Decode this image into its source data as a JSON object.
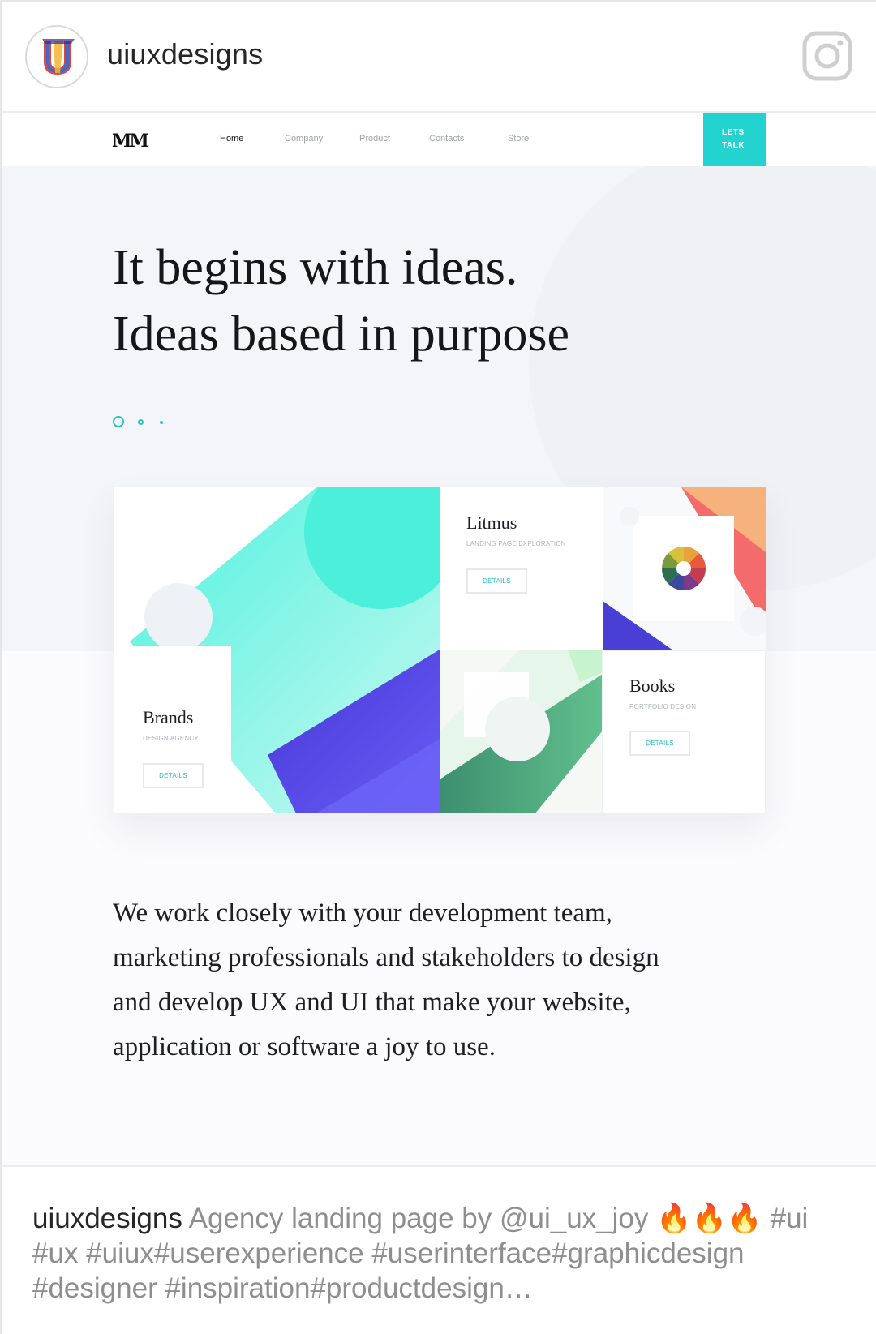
{
  "instagram": {
    "username": "uiuxdesigns",
    "avatar_icon": "uiuxdesigns-logo-icon",
    "app_icon": "instagram-icon"
  },
  "site": {
    "logo_text": "MM",
    "nav": [
      {
        "label": "Home",
        "active": true
      },
      {
        "label": "Company",
        "active": false
      },
      {
        "label": "Product",
        "active": false
      },
      {
        "label": "Contacts",
        "active": false
      },
      {
        "label": "Store",
        "active": false
      }
    ],
    "cta_line1": "LETS",
    "cta_line2": "TALK",
    "accent": "#22d3cf",
    "headline_line1": "It begins with ideas.",
    "headline_line2": "Ideas based in purpose",
    "cards": {
      "litmus": {
        "title": "Litmus",
        "subtitle": "LANDING PAGE EXPLORATION",
        "button": "DETAILS"
      },
      "brands": {
        "title": "Brands",
        "subtitle": "DESIGN AGENCY",
        "button": "DETAILS"
      },
      "books": {
        "title": "Books",
        "subtitle": "PORTFOLIO DESIGN",
        "button": "DETAILS"
      }
    },
    "body_lines": [
      "We work closely with your development team,",
      "marketing professionals and stakeholders to design",
      "and develop UX and UI that make your website,",
      "application or software a joy to use."
    ]
  },
  "caption": {
    "username": "uiuxdesigns",
    "line1_text": "Agency landing page by @ui_ux_joy ",
    "emoji": "🔥🔥🔥",
    "line1_tag": "#ui",
    "line2": "#ux #uiux#userexperience #userinterface#graphicdesign",
    "line3": "#designer #inspiration#productdesign…"
  }
}
